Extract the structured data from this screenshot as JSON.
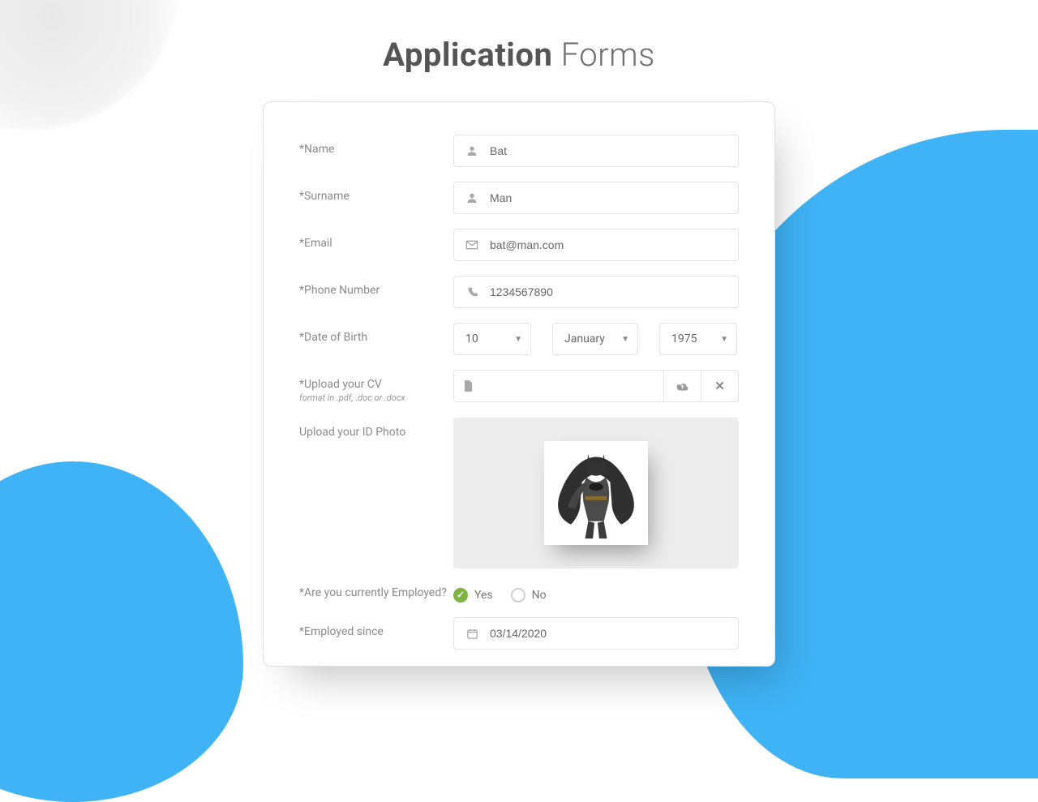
{
  "title": {
    "strong": "Application",
    "light": "Forms"
  },
  "labels": {
    "name": "*Name",
    "surname": "*Surname",
    "email": "*Email",
    "phone": "*Phone Number",
    "dob": "*Date of Birth",
    "cv": "*Upload your CV",
    "cv_hint": "format in .pdf, .doc or .docx",
    "photo": "Upload your ID Photo",
    "employed_q": "*Are you currently Employed?",
    "employed_since": "*Employed since"
  },
  "values": {
    "name": "Bat",
    "surname": "Man",
    "email": "bat@man.com",
    "phone": "1234567890",
    "dob_day": "10",
    "dob_month": "January",
    "dob_year": "1975",
    "cv_filename": "",
    "employed_yes": "Yes",
    "employed_no": "No",
    "employed_since": "03/14/2020"
  }
}
